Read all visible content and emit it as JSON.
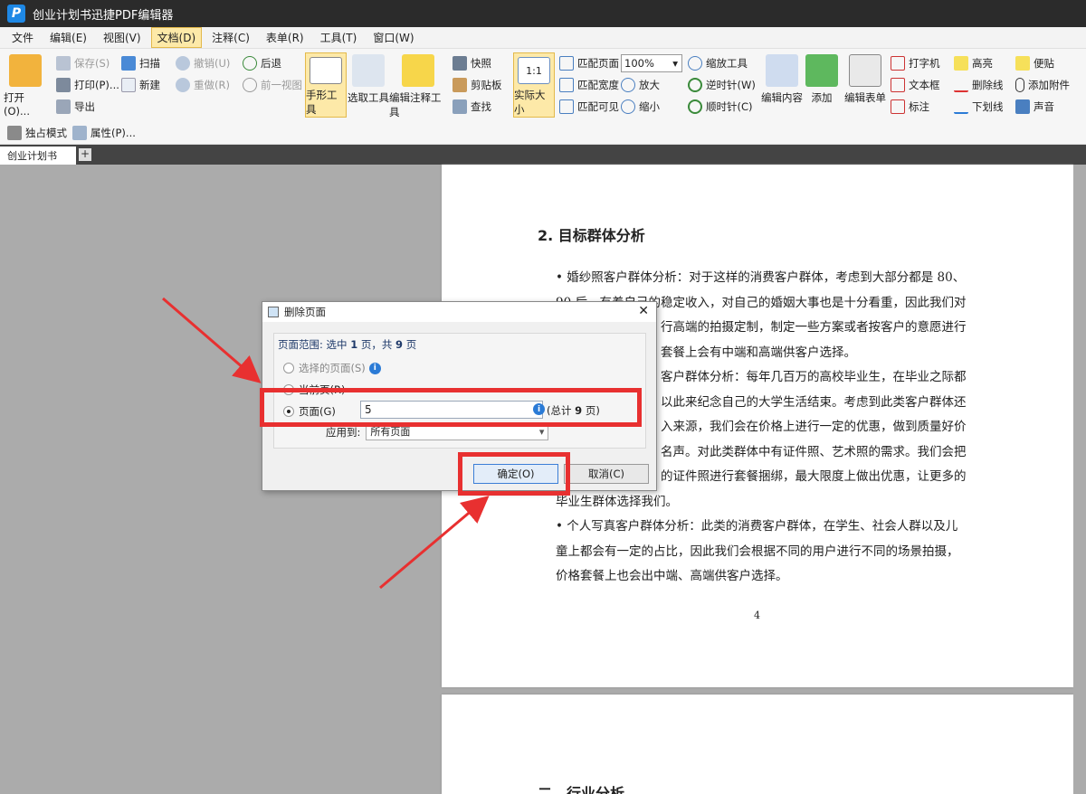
{
  "app": {
    "title": "创业计划书迅捷PDF编辑器",
    "logo_letter": "P"
  },
  "menu": [
    "文件",
    "编辑(E)",
    "视图(V)",
    "文档(D)",
    "注释(C)",
    "表单(R)",
    "工具(T)",
    "窗口(W)"
  ],
  "ribbon": {
    "open": "打开(O)...",
    "save": "保存(S)",
    "print": "打印(P)...",
    "export": "导出",
    "scan": "扫描",
    "new": "新建",
    "undo": "撤销(U)",
    "redo": "重做(R)",
    "back": "后退",
    "prev_view": "前一视图",
    "hand_tool": "手形工具",
    "select_tool": "选取工具",
    "edit_annot": "编辑注释工具",
    "snapshot": "快照",
    "clipboard": "剪贴板",
    "find": "查找",
    "actual_size": "实际大小",
    "actual_size_glyph": "1:1",
    "fit_page": "匹配页面",
    "fit_width": "匹配宽度",
    "fit_visible": "匹配可见",
    "zoom_value": "100%",
    "zoom_tool": "缩放工具",
    "zoom_in": "放大",
    "zoom_out": "缩小",
    "rotate_ccw": "逆时针(W)",
    "rotate_cw": "顺时针(C)",
    "edit_content": "编辑内容",
    "add": "添加",
    "edit_form": "编辑表单",
    "typewriter": "打字机",
    "textbox": "文本框",
    "callout": "标注",
    "highlight": "高亮",
    "strikeout": "删除线",
    "underline": "下划线",
    "note": "便贴",
    "attach": "添加附件",
    "sound": "声音"
  },
  "toolbar2": {
    "exclusive_mode": "独占模式",
    "properties": "属性(P)..."
  },
  "tabs": {
    "doc_tab": "创业计划书"
  },
  "doc": {
    "heading": "2. 目标群体分析",
    "lines": [
      "• 婚纱照客户群体分析：对于这样的消费客户群体，考虑到大部分都是 80、",
      "90 后，有着自己的稳定收入，对自己的婚姻大事也是十分看重，因此我们对",
      "行高端的拍摄定制，制定一些方案或者按客户的意愿进行",
      "套餐上会有中端和高端供客户选择。",
      "客户群体分析：每年几百万的高校毕业生，在毕业之际都",
      "以此来纪念自己的大学生活结束。考虑到此类客户群体还",
      "入来源，我们会在价格上进行一定的优惠，做到质量好价",
      "名声。对此类群体中有证件照、艺术照的需求。我们会把",
      "的证件照进行套餐捆绑，最大限度上做出优惠，让更多的",
      "毕业生群体选择我们。",
      "• 个人写真客户群体分析：此类的消费客户群体，在学生、社会人群以及儿",
      "童上都会有一定的占比，因此我们会根据不同的用户进行不同的场景拍摄，",
      "价格套餐上也会出中端、高端供客户选择。"
    ],
    "page_number": "4",
    "next_heading": "二、行业分析"
  },
  "dialog": {
    "title": "删除页面",
    "range_label": "页面范围: 选中",
    "selected_count": "1",
    "range_mid": "页，共",
    "total_count": "9",
    "range_end": "页",
    "opt_selected": "选择的页面(S)",
    "opt_current": "当前页(R)",
    "opt_pages": "页面(G)",
    "pages_value": "5",
    "total_note_pre": "(总计",
    "total_note_num": "9",
    "total_note_post": "页)",
    "apply_label": "应用到:",
    "apply_value": "所有页面",
    "ok": "确定(O)",
    "cancel": "取消(C)"
  },
  "colors": {
    "annotation": "#e83030",
    "accent": "#fde9a8"
  }
}
